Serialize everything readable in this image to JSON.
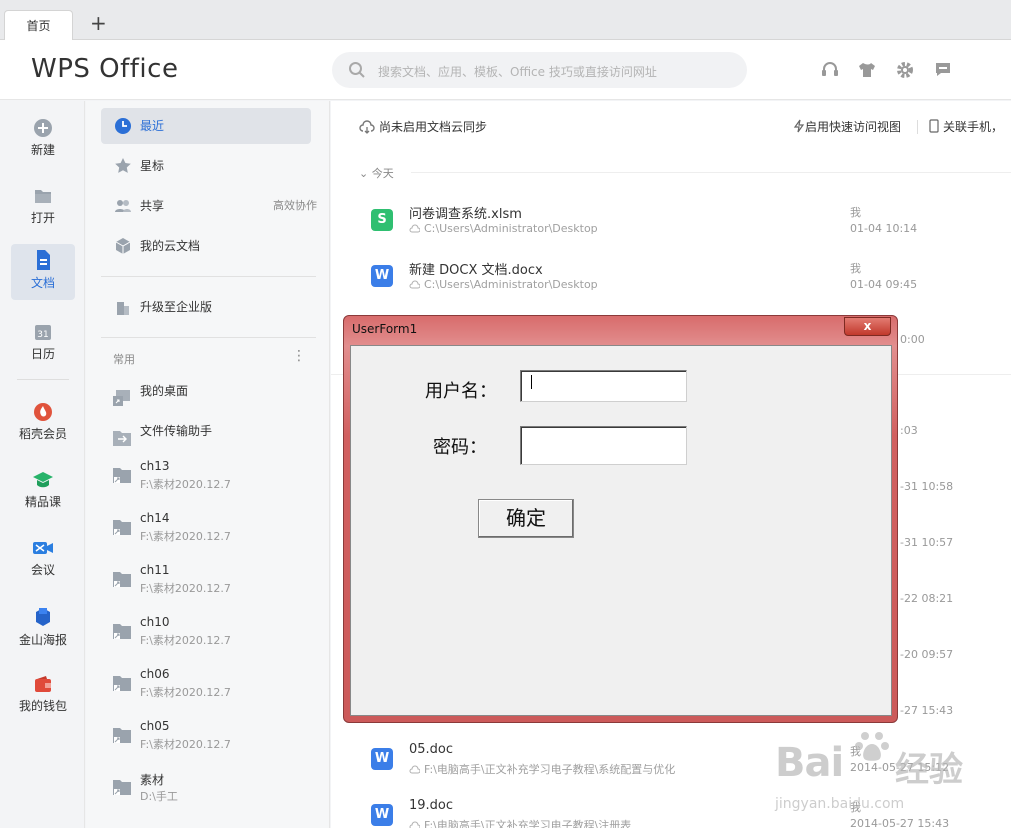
{
  "tabbar": {
    "tab_label": "首页",
    "add_label": "+"
  },
  "header": {
    "logo": "WPS Office",
    "search_placeholder": "搜索文档、应用、模板、Office 技巧或直接访问网址"
  },
  "leftbar": {
    "items": [
      {
        "label": "新建",
        "icon": "plus-circle-icon"
      },
      {
        "label": "打开",
        "icon": "folder-icon"
      },
      {
        "label": "文档",
        "icon": "document-icon"
      },
      {
        "label": "日历",
        "icon": "calendar-icon"
      },
      {
        "label": "稻壳会员",
        "icon": "member-icon"
      },
      {
        "label": "精品课",
        "icon": "course-icon"
      },
      {
        "label": "会议",
        "icon": "meeting-icon"
      },
      {
        "label": "金山海报",
        "icon": "poster-icon"
      },
      {
        "label": "我的钱包",
        "icon": "wallet-icon"
      }
    ],
    "calendar_day": "31"
  },
  "nav": {
    "items": [
      {
        "label": "最近"
      },
      {
        "label": "星标"
      },
      {
        "label": "共享",
        "extra": "高效协作"
      },
      {
        "label": "我的云文档"
      },
      {
        "label": "升级至企业版"
      }
    ],
    "common_label": "常用",
    "common_more": "⋮",
    "folders": [
      {
        "name": "我的桌面",
        "path": ""
      },
      {
        "name": "文件传输助手",
        "path": ""
      },
      {
        "name": "ch13",
        "path": "F:\\素材2020.12.7"
      },
      {
        "name": "ch14",
        "path": "F:\\素材2020.12.7"
      },
      {
        "name": "ch11",
        "path": "F:\\素材2020.12.7"
      },
      {
        "name": "ch10",
        "path": "F:\\素材2020.12.7"
      },
      {
        "name": "ch06",
        "path": "F:\\素材2020.12.7"
      },
      {
        "name": "ch05",
        "path": "F:\\素材2020.12.7"
      },
      {
        "name": "素材",
        "path": "D:\\手工"
      }
    ]
  },
  "main": {
    "sync_label": "尚未启用文档云同步",
    "quick_view_label": "启用快速访问视图",
    "mobile_label": "关联手机，",
    "today_label": "今天",
    "files": [
      {
        "badge": "S",
        "name": "问卷调查系统.xlsm",
        "path": "C:\\Users\\Administrator\\Desktop",
        "user": "我",
        "time": "01-04 10:14"
      },
      {
        "badge": "W",
        "name": "新建 DOCX 文档.docx",
        "path": "C:\\Users\\Administrator\\Desktop",
        "user": "我",
        "time": "01-04 09:45"
      },
      {
        "badge": "W",
        "name": "05.doc",
        "path": "F:\\电脑高手\\正文补充学习电子教程\\系统配置与优化",
        "user": "我",
        "time": "2014-05-27 15:12"
      },
      {
        "badge": "W",
        "name": "19.doc",
        "path": "F:\\电脑高手\\正文补充学习电子教程\\注册表",
        "user": "我",
        "time": "2014-05-27 15:43"
      }
    ],
    "partial_times": [
      "0:00",
      ":03",
      "-31 10:58",
      "-31 10:57",
      "-22 08:21",
      "-20 09:57",
      "-27 15:43"
    ]
  },
  "dialog": {
    "title": "UserForm1",
    "close_label": "x",
    "username_label": "用户名：",
    "username_value": "",
    "password_label": "密码：",
    "password_value": "",
    "ok_label": "确定"
  },
  "watermark": {
    "brand": "Bai",
    "brand_suffix": "经验",
    "url": "jingyan.baidu.com"
  },
  "colors": {
    "accent": "#2b6fd6",
    "dialog_frame": "#d16060",
    "xlsm_badge": "#2fbf71",
    "doc_badge": "#3b7ee8"
  }
}
